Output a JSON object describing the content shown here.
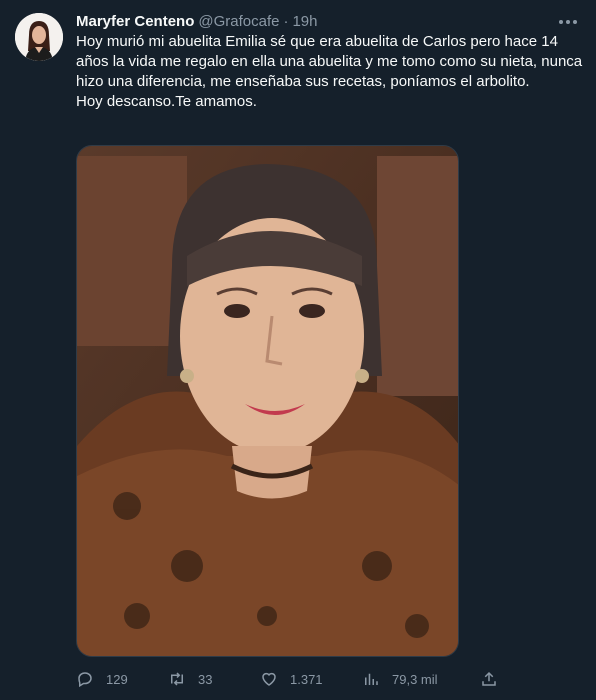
{
  "tweet": {
    "author_name": "Maryfer Centeno",
    "author_handle": "@Grafocafe",
    "separator": "·",
    "time_ago": "19h",
    "text_paragraph_1": "Hoy murió mi abuelita Emilia sé que era abuelita de Carlos pero hace 14 años la vida me regalo en ella una abuelita y me tomo como su nieta, nunca hizo una diferencia, me enseñaba sus recetas, poníamos el arbolito.",
    "text_paragraph_2": "Hoy descanso.Te amamos."
  },
  "actions": {
    "replies": "129",
    "retweets": "33",
    "likes": "1.371",
    "views": "79,3 mil"
  },
  "colors": {
    "background": "#15202b",
    "text_primary": "#f7f9f9",
    "text_secondary": "#8b98a5"
  },
  "icons": [
    "more-icon",
    "reply-icon",
    "retweet-icon",
    "like-icon",
    "views-icon",
    "share-icon"
  ]
}
